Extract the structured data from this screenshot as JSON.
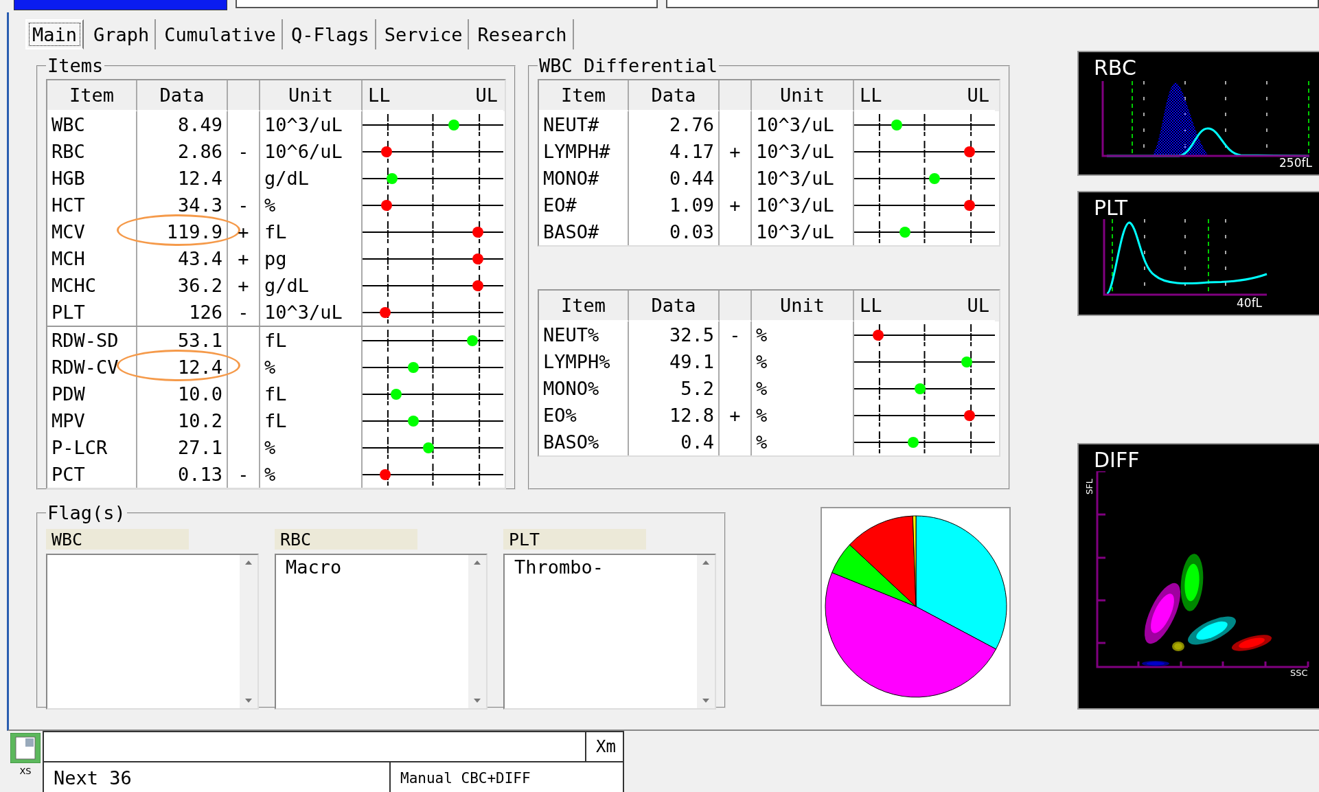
{
  "tabs": [
    {
      "label": "Main",
      "selected": true
    },
    {
      "label": "Graph",
      "selected": false
    },
    {
      "label": "Cumulative",
      "selected": false
    },
    {
      "label": "Q-Flags",
      "selected": false
    },
    {
      "label": "Service",
      "selected": false
    },
    {
      "label": "Research",
      "selected": false
    }
  ],
  "items": {
    "title": "Items",
    "columns": {
      "item": "Item",
      "data": "Data",
      "unit": "Unit",
      "ll": "LL",
      "ul": "UL"
    },
    "groups": [
      {
        "rows": [
          {
            "item": "WBC",
            "data": "8.49",
            "unit": "10^3/uL",
            "level": 0.65,
            "color": "#00ff00",
            "circled": false
          },
          {
            "item": "RBC",
            "data": "2.86",
            "flag": "-",
            "unit": "10^6/uL",
            "level": 0.17,
            "color": "#ff0000",
            "circled": false
          },
          {
            "item": "HGB",
            "data": "12.4",
            "unit": "g/dL",
            "level": 0.21,
            "color": "#00ff00",
            "circled": false
          },
          {
            "item": "HCT",
            "data": "34.3",
            "flag": "-",
            "unit": "%",
            "level": 0.17,
            "color": "#ff0000",
            "circled": false
          },
          {
            "item": "MCV",
            "data": "119.9",
            "flag": "+",
            "unit": "fL",
            "level": 0.82,
            "color": "#ff0000",
            "circled": true
          },
          {
            "item": "MCH",
            "data": "43.4",
            "flag": "+",
            "unit": "pg",
            "level": 0.82,
            "color": "#ff0000",
            "circled": false
          },
          {
            "item": "MCHC",
            "data": "36.2",
            "flag": "+",
            "unit": "g/dL",
            "level": 0.82,
            "color": "#ff0000",
            "circled": false
          },
          {
            "item": "PLT",
            "data": "126",
            "flag": "-",
            "unit": "10^3/uL",
            "level": 0.16,
            "color": "#ff0000",
            "circled": false
          }
        ]
      },
      {
        "rows": [
          {
            "item": "RDW-SD",
            "data": "53.1",
            "unit": "fL",
            "level": 0.78,
            "color": "#00ff00",
            "circled": false
          },
          {
            "item": "RDW-CV",
            "data": "12.4",
            "unit": "%",
            "level": 0.36,
            "color": "#00ff00",
            "circled": true
          },
          {
            "item": "PDW",
            "data": "10.0",
            "unit": "fL",
            "level": 0.24,
            "color": "#00ff00",
            "circled": false
          },
          {
            "item": "MPV",
            "data": "10.2",
            "unit": "fL",
            "level": 0.36,
            "color": "#00ff00",
            "circled": false
          },
          {
            "item": "P-LCR",
            "data": "27.1",
            "unit": "%",
            "level": 0.47,
            "color": "#00ff00",
            "circled": false
          },
          {
            "item": "PCT",
            "data": "0.13",
            "flag": "-",
            "unit": "%",
            "level": 0.16,
            "color": "#ff0000",
            "circled": false
          }
        ]
      }
    ]
  },
  "wbc_differential": {
    "title": "WBC Differential",
    "tables": [
      {
        "columns": {
          "item": "Item",
          "data": "Data",
          "unit": "Unit",
          "ll": "LL",
          "ul": "UL"
        },
        "rows": [
          {
            "item": "NEUT#",
            "data": "2.76",
            "unit": "10^3/uL",
            "level": 0.3,
            "color": "#00ff00"
          },
          {
            "item": "LYMPH#",
            "data": "4.17",
            "flag": "+",
            "unit": "10^3/uL",
            "level": 0.82,
            "color": "#ff0000"
          },
          {
            "item": "MONO#",
            "data": "0.44",
            "unit": "10^3/uL",
            "level": 0.57,
            "color": "#00ff00"
          },
          {
            "item": "EO#",
            "data": "1.09",
            "flag": "+",
            "unit": "10^3/uL",
            "level": 0.82,
            "color": "#ff0000"
          },
          {
            "item": "BASO#",
            "data": "0.03",
            "unit": "10^3/uL",
            "level": 0.36,
            "color": "#00ff00"
          }
        ]
      },
      {
        "columns": {
          "item": "Item",
          "data": "Data",
          "unit": "Unit",
          "ll": "LL",
          "ul": "UL"
        },
        "rows": [
          {
            "item": "NEUT%",
            "data": "32.5",
            "flag": "-",
            "unit": "%",
            "level": 0.17,
            "color": "#ff0000"
          },
          {
            "item": "LYMPH%",
            "data": "49.1",
            "unit": "%",
            "level": 0.8,
            "color": "#00ff00"
          },
          {
            "item": "MONO%",
            "data": "5.2",
            "unit": "%",
            "level": 0.47,
            "color": "#00ff00"
          },
          {
            "item": "EO%",
            "data": "12.8",
            "flag": "+",
            "unit": "%",
            "level": 0.82,
            "color": "#ff0000"
          },
          {
            "item": "BASO%",
            "data": "0.4",
            "unit": "%",
            "level": 0.42,
            "color": "#00ff00"
          }
        ]
      }
    ]
  },
  "flags": {
    "title": "Flag(s)",
    "lists": [
      {
        "label": "WBC"
      },
      {
        "label": "RBC",
        "entries": [
          "Macro"
        ]
      },
      {
        "label": "PLT",
        "entries": [
          "Thrombo-"
        ]
      }
    ]
  },
  "histograms": [
    {
      "kind": "rbc",
      "title": "RBC",
      "scale": "250fL"
    },
    {
      "kind": "plt",
      "title": "PLT",
      "scale": "40fL"
    }
  ],
  "scattergram": {
    "title": "DIFF",
    "y_axis": "SFL",
    "x_axis": "SSC"
  },
  "status_bar": {
    "mode": "XS",
    "field_label": "Xm",
    "next": "Next 36",
    "order": "Manual CBC+DIFF"
  }
}
